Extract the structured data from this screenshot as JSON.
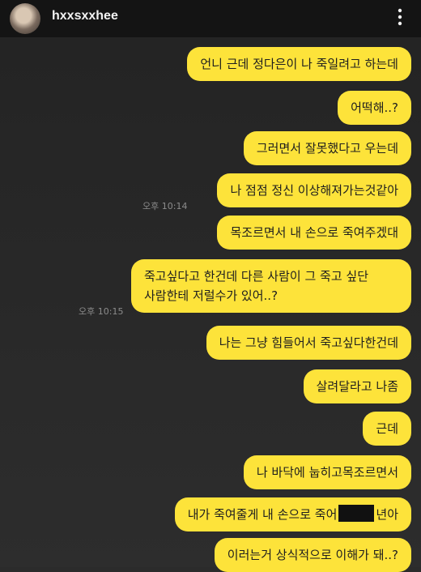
{
  "header": {
    "username": "hxxsxxhee",
    "more_icon": "more-vertical-icon"
  },
  "colors": {
    "bubble": "#fde33a",
    "background": "#2b2b2b",
    "header": "#141414"
  },
  "messages": [
    {
      "text": "언니 근데 정다은이 나 죽일려고 하는데"
    },
    {
      "text": "어떡해..?"
    },
    {
      "text": "그러면서 잘못했다고 우는데"
    },
    {
      "text": "나 점점 정신 이상해져가는것같아"
    },
    {
      "text": "목조르면서 내 손으로 죽여주겠대"
    },
    {
      "line1": "죽고싶다고 한건데 다른 사람이 그 죽고 싶단",
      "line2": "사람한테 저럴수가 있어..?"
    },
    {
      "text": "나는 그냥 힘들어서 죽고싶다한건데"
    },
    {
      "text": "살려달라고 나좀"
    },
    {
      "text": "근데"
    },
    {
      "text": "나 바닥에 눕히고목조르면서"
    },
    {
      "before": "내가 죽여줄게 내 손으로 죽어",
      "after": "년아"
    },
    {
      "text": "이러는거 상식적으로 이해가 돼..?"
    }
  ],
  "timestamps": {
    "first": "오후 10:14",
    "second": "오후 10:15"
  }
}
